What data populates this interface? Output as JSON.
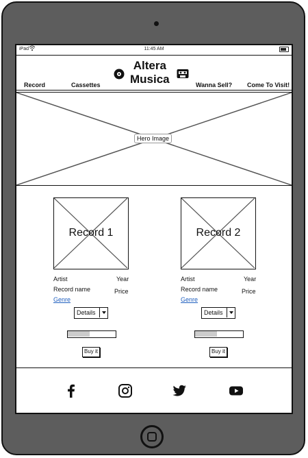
{
  "status_bar": {
    "carrier": "iPad",
    "time": "11:45 AM"
  },
  "header": {
    "brand_line1": "Altera",
    "brand_line2": "Musica",
    "nav": {
      "record": "Record",
      "cassettes": "Cassettes",
      "wanna_sell": "Wanna Sell?",
      "visit": "Come To Visit!"
    },
    "icons": {
      "left": "vinyl-record-icon",
      "right": "cassette-icon"
    }
  },
  "hero": {
    "label": "Hero Image"
  },
  "products": [
    {
      "title": "Record 1",
      "artist": "Artist",
      "year": "Year",
      "record_name": "Record name",
      "price": "Price",
      "genre": "Genre",
      "details": "Details",
      "slider_fill": 0.45,
      "buy": "Buy it"
    },
    {
      "title": "Record 2",
      "artist": "Artist",
      "year": "Year",
      "record_name": "Record name",
      "price": "Price",
      "genre": "Genre",
      "details": "Details",
      "slider_fill": 0.45,
      "buy": "Buy it"
    }
  ],
  "footer": {
    "social": [
      "facebook-icon",
      "instagram-icon",
      "twitter-icon",
      "youtube-icon"
    ]
  },
  "colors": {
    "device": "#5d5d5d",
    "link": "#1f5fbf",
    "slider_fill": "#cccccc"
  }
}
